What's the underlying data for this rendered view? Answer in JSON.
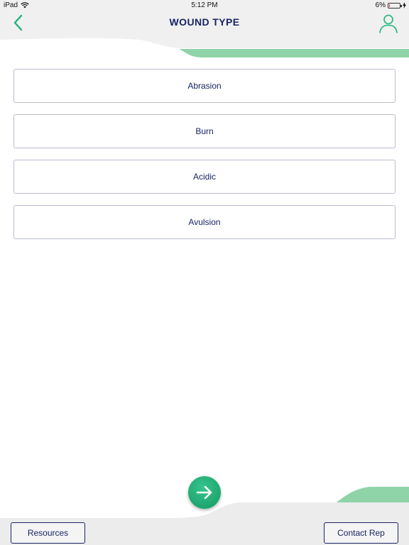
{
  "status_bar": {
    "device": "iPad",
    "time": "5:12 PM",
    "battery_percent": "6%",
    "battery_level": 0.06
  },
  "header": {
    "title": "WOUND TYPE"
  },
  "wound_types": [
    {
      "label": "Abrasion"
    },
    {
      "label": "Burn"
    },
    {
      "label": "Acidic"
    },
    {
      "label": "Avulsion"
    }
  ],
  "footer": {
    "resources_label": "Resources",
    "contact_label": "Contact Rep"
  },
  "colors": {
    "accent_green": "#1fb47a",
    "wave_green": "#8fd3a9",
    "navy": "#1a2463",
    "battery_low": "#e23b3b"
  },
  "icons": {
    "back": "chevron-left-icon",
    "profile": "user-icon",
    "next": "arrow-right-icon",
    "wifi": "wifi-icon",
    "battery": "battery-icon",
    "charging": "bolt-icon"
  }
}
